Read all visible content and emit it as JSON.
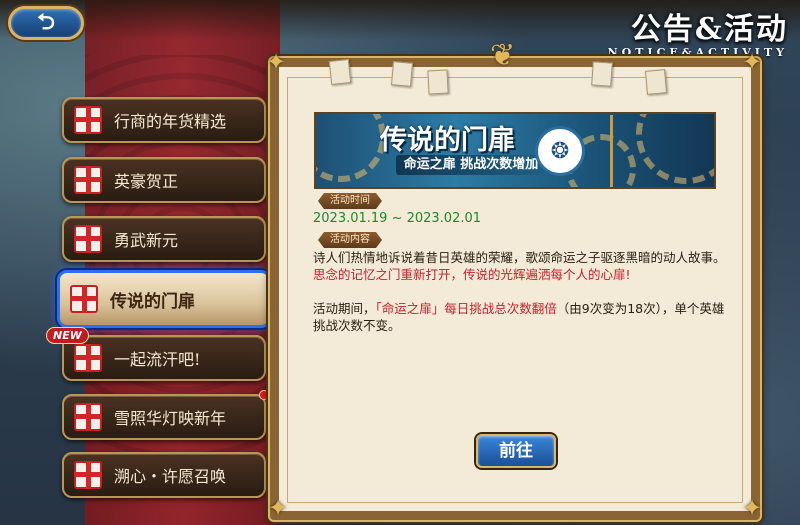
{
  "header": {
    "back_label": "⮌",
    "title_cn": "公告&活动",
    "title_en": "NOTICE&ACTIVITY"
  },
  "sidebar": {
    "items": [
      {
        "label": "行商的年货精选",
        "active": false,
        "badge": "",
        "dot": false
      },
      {
        "label": "英豪贺正",
        "active": false,
        "badge": "",
        "dot": false
      },
      {
        "label": "勇武新元",
        "active": false,
        "badge": "",
        "dot": false
      },
      {
        "label": "传说的门扉",
        "active": true,
        "badge": "",
        "dot": false
      },
      {
        "label": "一起流汗吧!",
        "active": false,
        "badge": "NEW",
        "dot": false
      },
      {
        "label": "雪照华灯映新年",
        "active": false,
        "badge": "",
        "dot": true
      },
      {
        "label": "溯心・许愿召唤",
        "active": false,
        "badge": "",
        "dot": false
      }
    ]
  },
  "banner": {
    "title": "传说的门扉",
    "subtitle": "命运之扉 挑战次数增加"
  },
  "activity": {
    "time_label": "活动时间",
    "time_value": "2023.01.19 ~ 2023.02.01",
    "content_label": "活动内容",
    "para1_normal": "诗人们热情地诉说着昔日英雄的荣耀，歌颂命运之子驱逐黑暗的动人故事。",
    "para1_highlight": "思念的记忆之门重新打开，传说的光辉遍洒每个人的心扉!",
    "para2_prefix": "活动期间，",
    "para2_highlight": "「命运之扉」每日挑战总次数翻倍",
    "para2_suffix": "（由9次变为18次），单个英雄挑战次数不变。",
    "button_label": "前往"
  },
  "colors": {
    "date_green": "#1a8a2b",
    "highlight_red": "#c81f2a",
    "active_border": "#2e6ff0",
    "gold": "#d9b56a"
  }
}
